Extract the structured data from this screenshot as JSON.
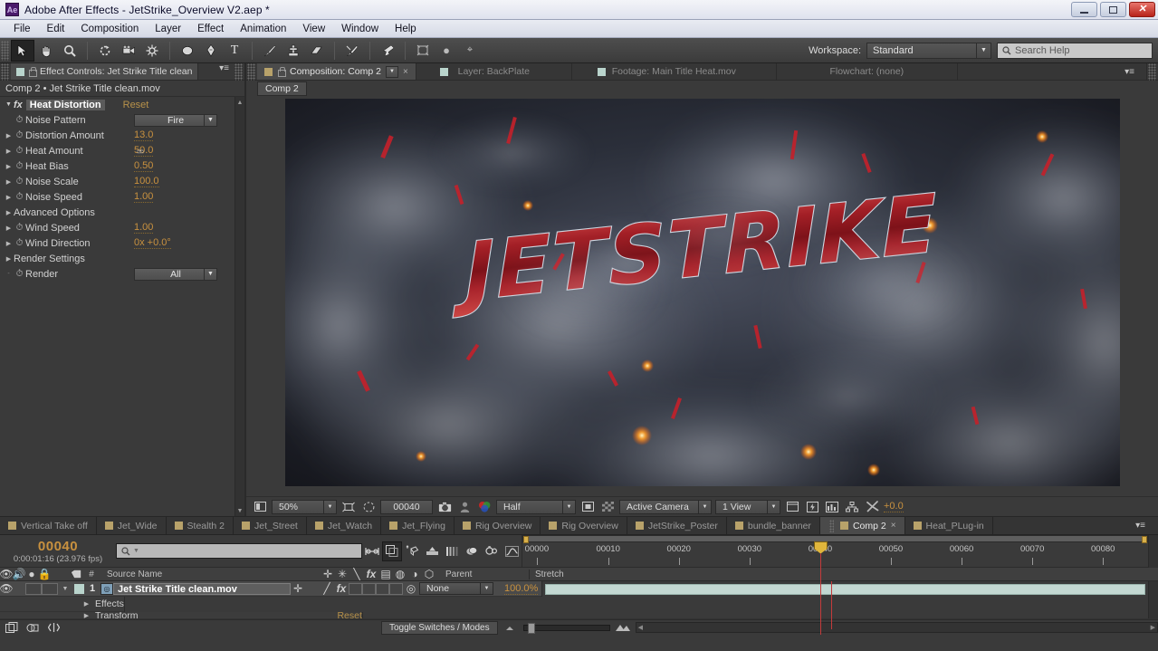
{
  "window": {
    "app_icon": "Ae",
    "title": "Adobe After Effects - JetStrike_Overview V2.aep *",
    "minimize": "–",
    "maximize": "□",
    "close": "✕"
  },
  "menubar": {
    "items": [
      "File",
      "Edit",
      "Composition",
      "Layer",
      "Effect",
      "Animation",
      "View",
      "Window",
      "Help"
    ]
  },
  "toolbar": {
    "workspace_label": "Workspace:",
    "workspace_value": "Standard",
    "search_help_placeholder": "Search Help",
    "tools": [
      {
        "name": "selection-tool",
        "glyph": "➤",
        "selected": true
      },
      {
        "name": "hand-tool",
        "glyph": "✋",
        "selected": false
      },
      {
        "name": "zoom-tool",
        "glyph": "🔍",
        "selected": false
      },
      {
        "name": "rotation-tool",
        "glyph": "↻",
        "selected": false
      },
      {
        "name": "camera-tool",
        "glyph": "🎥",
        "selected": false
      },
      {
        "name": "pan-behind-tool",
        "glyph": "✥",
        "selected": false
      },
      {
        "name": "shape-tool",
        "glyph": "●",
        "selected": false
      },
      {
        "name": "pen-tool",
        "glyph": "✒",
        "selected": false
      },
      {
        "name": "type-tool",
        "glyph": "T",
        "selected": false
      },
      {
        "name": "brush-tool",
        "glyph": "🖌",
        "selected": false
      },
      {
        "name": "clone-stamp-tool",
        "glyph": "⚲",
        "selected": false
      },
      {
        "name": "eraser-tool",
        "glyph": "◣",
        "selected": false
      },
      {
        "name": "roto-brush-tool",
        "glyph": "✎",
        "selected": false
      },
      {
        "name": "puppet-pin-tool",
        "glyph": "✧",
        "selected": false
      }
    ]
  },
  "effect_controls": {
    "tab_title": "Effect Controls: Jet Strike Title clean",
    "header": "Comp 2 • Jet Strike Title clean.mov",
    "effect_name": "Heat Distortion",
    "reset_label": "Reset",
    "properties": [
      {
        "name": "Noise Pattern",
        "type": "dropdown",
        "value": "Fire",
        "expandable": false
      },
      {
        "name": "Distortion Amount",
        "type": "value",
        "value": "13.0",
        "expandable": true
      },
      {
        "name": "Heat Amount",
        "type": "value",
        "value": "50.0",
        "expandable": true,
        "hovered": true
      },
      {
        "name": "Heat Bias",
        "type": "value",
        "value": "0.50",
        "expandable": true
      },
      {
        "name": "Noise Scale",
        "type": "value",
        "value": "100.0",
        "expandable": true
      },
      {
        "name": "Noise Speed",
        "type": "value",
        "value": "1.00",
        "expandable": true
      },
      {
        "name": "Advanced Options",
        "type": "group",
        "value": "",
        "expandable": true
      },
      {
        "name": "Wind Speed",
        "type": "value",
        "value": "1.00",
        "expandable": true
      },
      {
        "name": "Wind Direction",
        "type": "value",
        "value": "0x +0.0°",
        "expandable": true
      },
      {
        "name": "Render Settings",
        "type": "group",
        "value": "",
        "expandable": true
      },
      {
        "name": "Render",
        "type": "dropdown",
        "value": "All",
        "expandable": false
      }
    ]
  },
  "viewer": {
    "tabs": [
      {
        "label": "Composition: Comp 2",
        "active": true,
        "closable": true,
        "swatch": "gold"
      },
      {
        "label": "Layer: BackPlate",
        "active": false,
        "closable": false,
        "swatch": "green"
      },
      {
        "label": "Footage: Main Title Heat.mov",
        "active": false,
        "closable": false,
        "swatch": "green"
      },
      {
        "label": "Flowchart: (none)",
        "active": false,
        "closable": false,
        "swatch": "none"
      }
    ],
    "breadcrumb": "Comp 2",
    "title_text": "JETSTRIKE",
    "controls": {
      "zoom": "50%",
      "timecode": "00040",
      "resolution": "Half",
      "camera": "Active Camera",
      "views": "1 View",
      "exposure": "+0.0"
    }
  },
  "comp_tabs": [
    {
      "label": "Vertical Take off",
      "active": false
    },
    {
      "label": "Jet_Wide",
      "active": false
    },
    {
      "label": "Stealth 2",
      "active": false
    },
    {
      "label": "Jet_Street",
      "active": false
    },
    {
      "label": "Jet_Watch",
      "active": false
    },
    {
      "label": "Jet_Flying",
      "active": false
    },
    {
      "label": "Rig Overview",
      "active": false
    },
    {
      "label": "Rig Overview",
      "active": false
    },
    {
      "label": "JetStrike_Poster",
      "active": false
    },
    {
      "label": "bundle_banner",
      "active": false
    },
    {
      "label": "Comp 2",
      "active": true
    },
    {
      "label": "Heat_PLug-in",
      "active": false
    }
  ],
  "timeline": {
    "current_frame": "00040",
    "current_time": "0:00:01:16 (23.976 fps)",
    "search_placeholder": "",
    "columns": {
      "source_name": "Source Name",
      "parent": "Parent",
      "stretch": "Stretch",
      "number": "#"
    },
    "ruler_labels": [
      "00000",
      "00010",
      "00020",
      "00030",
      "00040",
      "00050",
      "00060",
      "00070",
      "00080"
    ],
    "layer": {
      "index": "1",
      "name": "Jet Strike Title clean.mov",
      "parent": "None",
      "stretch": "100.0%"
    },
    "sub_rows": [
      {
        "label": "Effects",
        "value": ""
      },
      {
        "label": "Transform",
        "value": "Reset"
      }
    ],
    "toggle_switches": "Toggle Switches / Modes"
  },
  "colors": {
    "accent_orange": "#c8913f",
    "panel_bg": "#3a3a3a",
    "clip_green": "#c3d8d2",
    "cti_red": "#c43b3b",
    "title_red": "#a81f28"
  }
}
